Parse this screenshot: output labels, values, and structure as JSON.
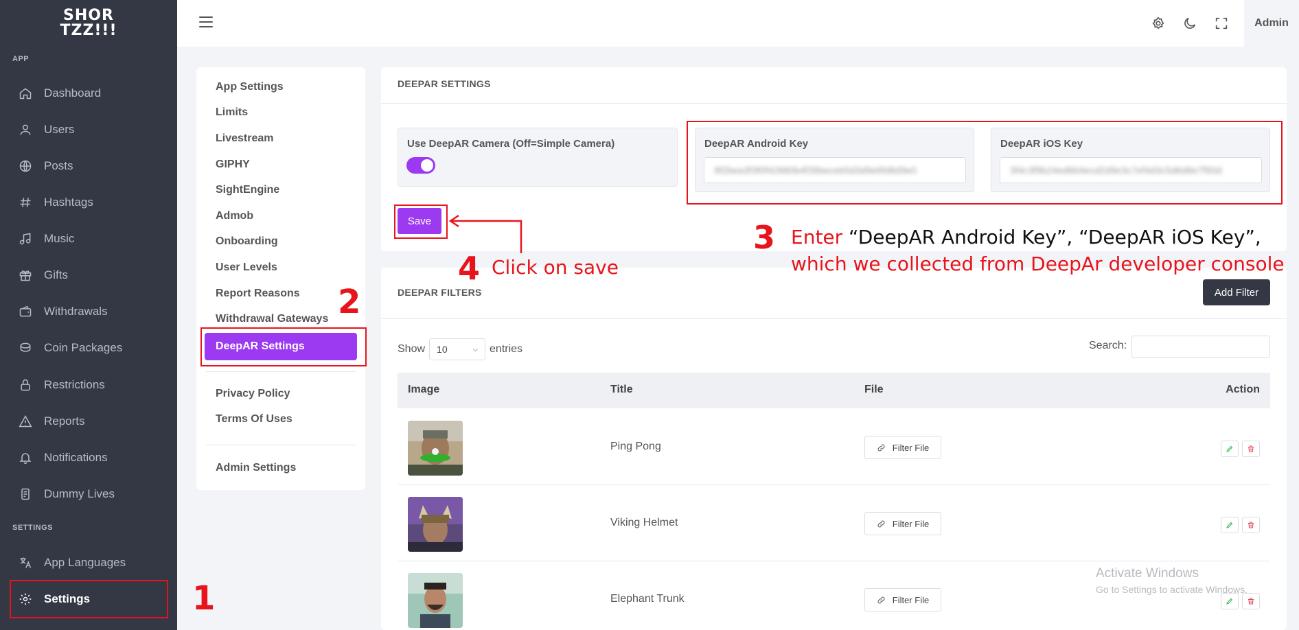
{
  "brand": {
    "line1": "SHOR",
    "line2": "TZZ!!!"
  },
  "sidebar": {
    "section_app": "APP",
    "section_settings": "SETTINGS",
    "items": [
      {
        "label": "Dashboard",
        "icon": "home-icon"
      },
      {
        "label": "Users",
        "icon": "user-icon"
      },
      {
        "label": "Posts",
        "icon": "globe-icon"
      },
      {
        "label": "Hashtags",
        "icon": "hash-icon"
      },
      {
        "label": "Music",
        "icon": "music-icon"
      },
      {
        "label": "Gifts",
        "icon": "gift-icon"
      },
      {
        "label": "Withdrawals",
        "icon": "wallet-icon"
      },
      {
        "label": "Coin Packages",
        "icon": "coins-icon"
      },
      {
        "label": "Restrictions",
        "icon": "lock-icon"
      },
      {
        "label": "Reports",
        "icon": "warning-icon"
      },
      {
        "label": "Notifications",
        "icon": "bell-icon"
      },
      {
        "label": "Dummy Lives",
        "icon": "device-icon"
      }
    ],
    "settings_items": [
      {
        "label": "App Languages",
        "icon": "translate-icon"
      },
      {
        "label": "Settings",
        "icon": "gear-icon"
      }
    ]
  },
  "topbar": {
    "admin_label": "Admin"
  },
  "submenu": {
    "items": [
      "App Settings",
      "Limits",
      "Livestream",
      "GIPHY",
      "SightEngine",
      "Admob",
      "Onboarding",
      "User Levels",
      "Report Reasons",
      "Withdrawal Gateways"
    ],
    "active": "DeepAR Settings",
    "privacy": "Privacy Policy",
    "terms": "Terms Of Uses",
    "admin_settings": "Admin Settings"
  },
  "deepar_settings": {
    "title": "DEEPAR SETTINGS",
    "camera_label": "Use DeepAR Camera (Off=Simple Camera)",
    "camera_enabled": true,
    "android_label": "DeepAR Android Key",
    "android_value": "9f2bea3f3f0f42880b4f39beceb5d3d9e6fd6d9e0",
    "ios_label": "DeepAR iOS Key",
    "ios_value": "3f4c3f9b24ed6b9ecd2d9e3c7ef4d3c5d6d8e7f90d",
    "save_label": "Save"
  },
  "deepar_filters": {
    "title": "DEEPAR FILTERS",
    "add_label": "Add Filter",
    "show_label": "Show",
    "page_size": "10",
    "entries_label": "entries",
    "search_label": "Search:",
    "columns": [
      "Image",
      "Title",
      "File",
      "Action"
    ],
    "file_button": "Filter File",
    "rows": [
      {
        "title": "Ping Pong"
      },
      {
        "title": "Viking Helmet"
      },
      {
        "title": "Elephant Trunk"
      }
    ]
  },
  "annotations": {
    "n1": "1",
    "n2": "2",
    "n3": "3",
    "n4": "4",
    "step3_prefix": "Enter",
    "step3_keys": " “DeepAR Android Key”,  “DeepAR iOS Key”,",
    "step3_line2": "which we collected from DeepAr developer console",
    "step4": "Click on save"
  },
  "watermark": {
    "line1": "Activate Windows",
    "line2": "Go to Settings to activate Windows."
  },
  "colors": {
    "accent": "#9b3af1",
    "sidebar": "#343744",
    "annotation_red": "#e8141b"
  }
}
